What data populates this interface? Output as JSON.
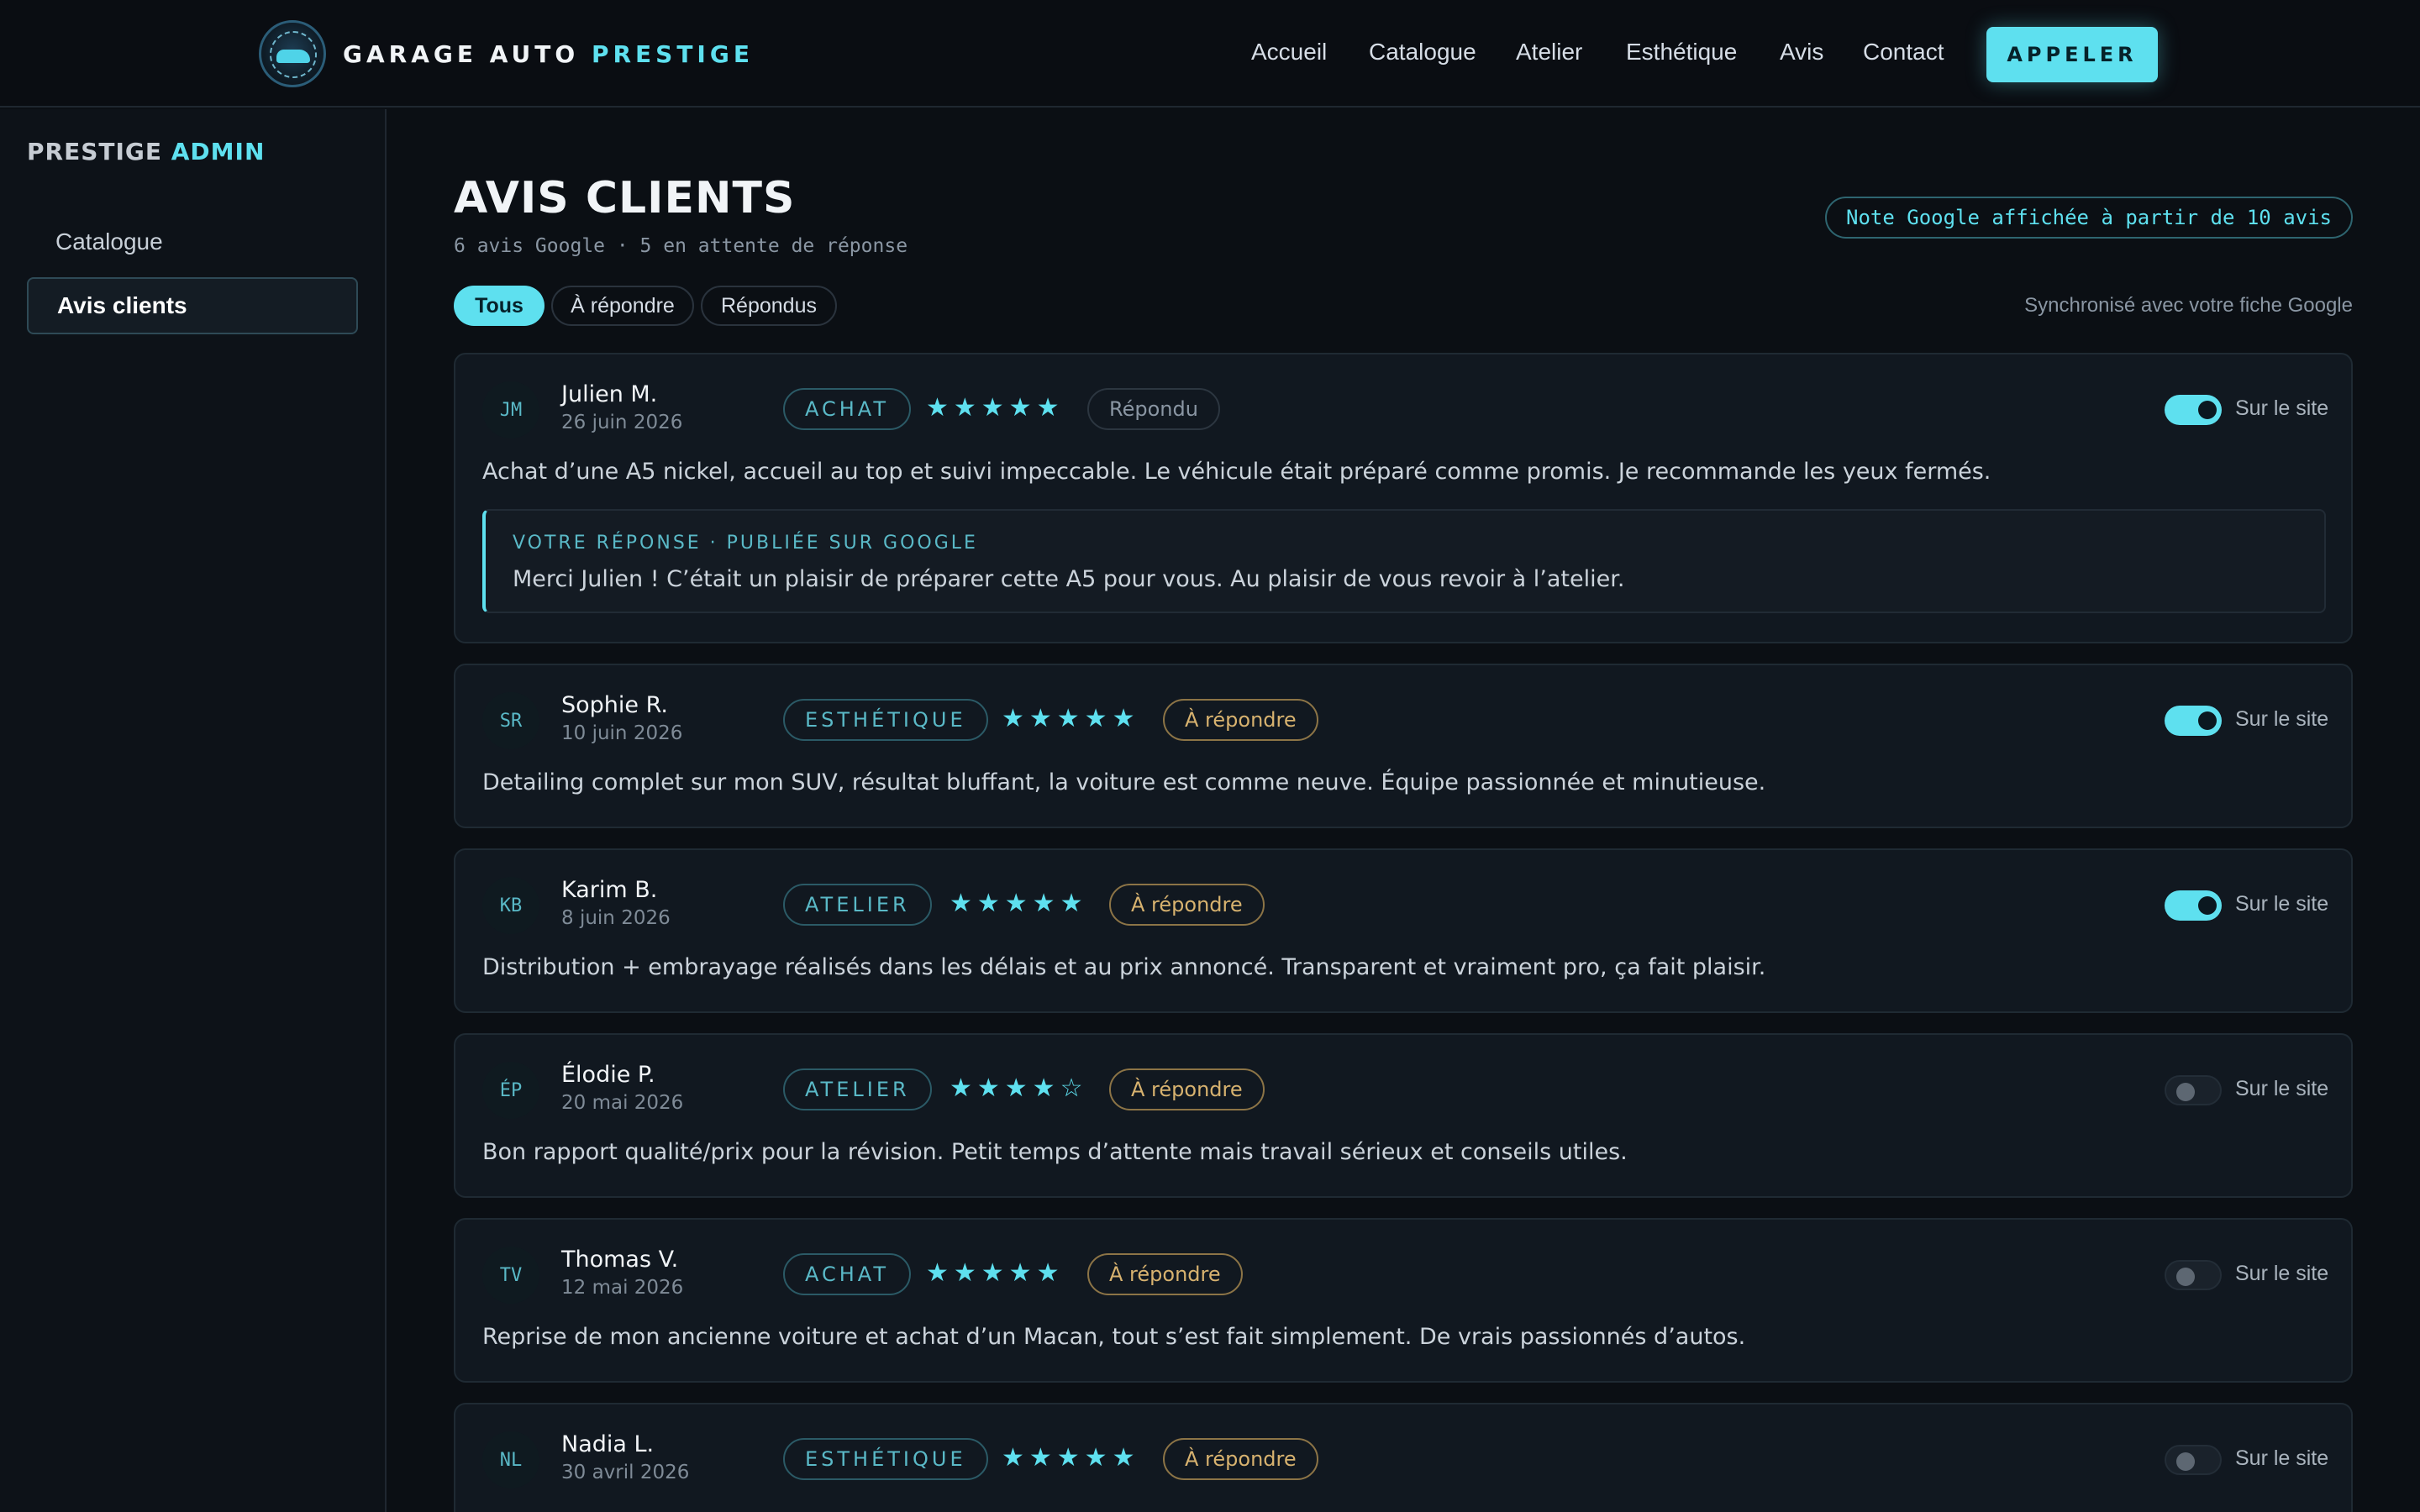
{
  "header": {
    "brand_main": "GARAGE AUTO ",
    "brand_accent": "PRESTIGE",
    "logo_icon": "garage-logo-car-badge",
    "nav": [
      "Accueil",
      "Catalogue",
      "Atelier",
      "Esthétique",
      "Avis",
      "Contact"
    ],
    "call_label": "APPELER"
  },
  "sidebar": {
    "title_main": "PRESTIGE ",
    "title_accent": "ADMIN",
    "items": [
      {
        "label": "Catalogue",
        "active": false
      },
      {
        "label": "Avis clients",
        "active": true
      }
    ]
  },
  "main": {
    "title": "AVIS CLIENTS",
    "subtitle": "6 avis Google · 5 en attente de réponse",
    "note": "Note Google affichée à partir de 10 avis",
    "filters": [
      {
        "label": "Tous",
        "active": true
      },
      {
        "label": "À répondre",
        "active": false
      },
      {
        "label": "Répondus",
        "active": false
      }
    ],
    "sync": "Synchronisé avec votre fiche Google",
    "site_label": "Sur le site",
    "reviews": [
      {
        "initials": "JM",
        "name": "Julien M.",
        "date": "26 juin 2026",
        "category": "ACHAT",
        "stars": "★★★★★",
        "rating": 5,
        "status": "Répondu",
        "status_type": "done",
        "on_site": true,
        "text": "Achat d’une A5 nickel, accueil au top et suivi impeccable. Le véhicule était préparé comme promis. Je recommande les yeux fermés.",
        "reply_label": "VOTRE RÉPONSE · PUBLIÉE SUR GOOGLE",
        "reply_text": "Merci Julien ! C’était un plaisir de préparer cette A5 pour vous. Au plaisir de vous revoir à l’atelier."
      },
      {
        "initials": "SR",
        "name": "Sophie R.",
        "date": "10 juin 2026",
        "category": "ESTHÉTIQUE",
        "stars": "★★★★★",
        "rating": 5,
        "status": "À répondre",
        "status_type": "todo",
        "on_site": true,
        "text": "Detailing complet sur mon SUV, résultat bluffant, la voiture est comme neuve. Équipe passionnée et minutieuse."
      },
      {
        "initials": "KB",
        "name": "Karim B.",
        "date": "8 juin 2026",
        "category": "ATELIER",
        "stars": "★★★★★",
        "rating": 5,
        "status": "À répondre",
        "status_type": "todo",
        "on_site": true,
        "text": "Distribution + embrayage réalisés dans les délais et au prix annoncé. Transparent et vraiment pro, ça fait plaisir."
      },
      {
        "initials": "ÉP",
        "name": "Élodie P.",
        "date": "20 mai 2026",
        "category": "ATELIER",
        "stars": "★★★★☆",
        "rating": 4,
        "status": "À répondre",
        "status_type": "todo",
        "on_site": false,
        "text": "Bon rapport qualité/prix pour la révision. Petit temps d’attente mais travail sérieux et conseils utiles."
      },
      {
        "initials": "TV",
        "name": "Thomas V.",
        "date": "12 mai 2026",
        "category": "ACHAT",
        "stars": "★★★★★",
        "rating": 5,
        "status": "À répondre",
        "status_type": "todo",
        "on_site": false,
        "text": "Reprise de mon ancienne voiture et achat d’un Macan, tout s’est fait simplement. De vrais passionnés d’autos."
      },
      {
        "initials": "NL",
        "name": "Nadia L.",
        "date": "30 avril 2026",
        "category": "ESTHÉTIQUE",
        "stars": "★★★★★",
        "rating": 5,
        "status": "À répondre",
        "status_type": "todo",
        "on_site": false,
        "text": ""
      }
    ]
  },
  "colors": {
    "accent": "#5ee0ef",
    "background": "#0b0f14",
    "pending": "#d7b26f"
  }
}
